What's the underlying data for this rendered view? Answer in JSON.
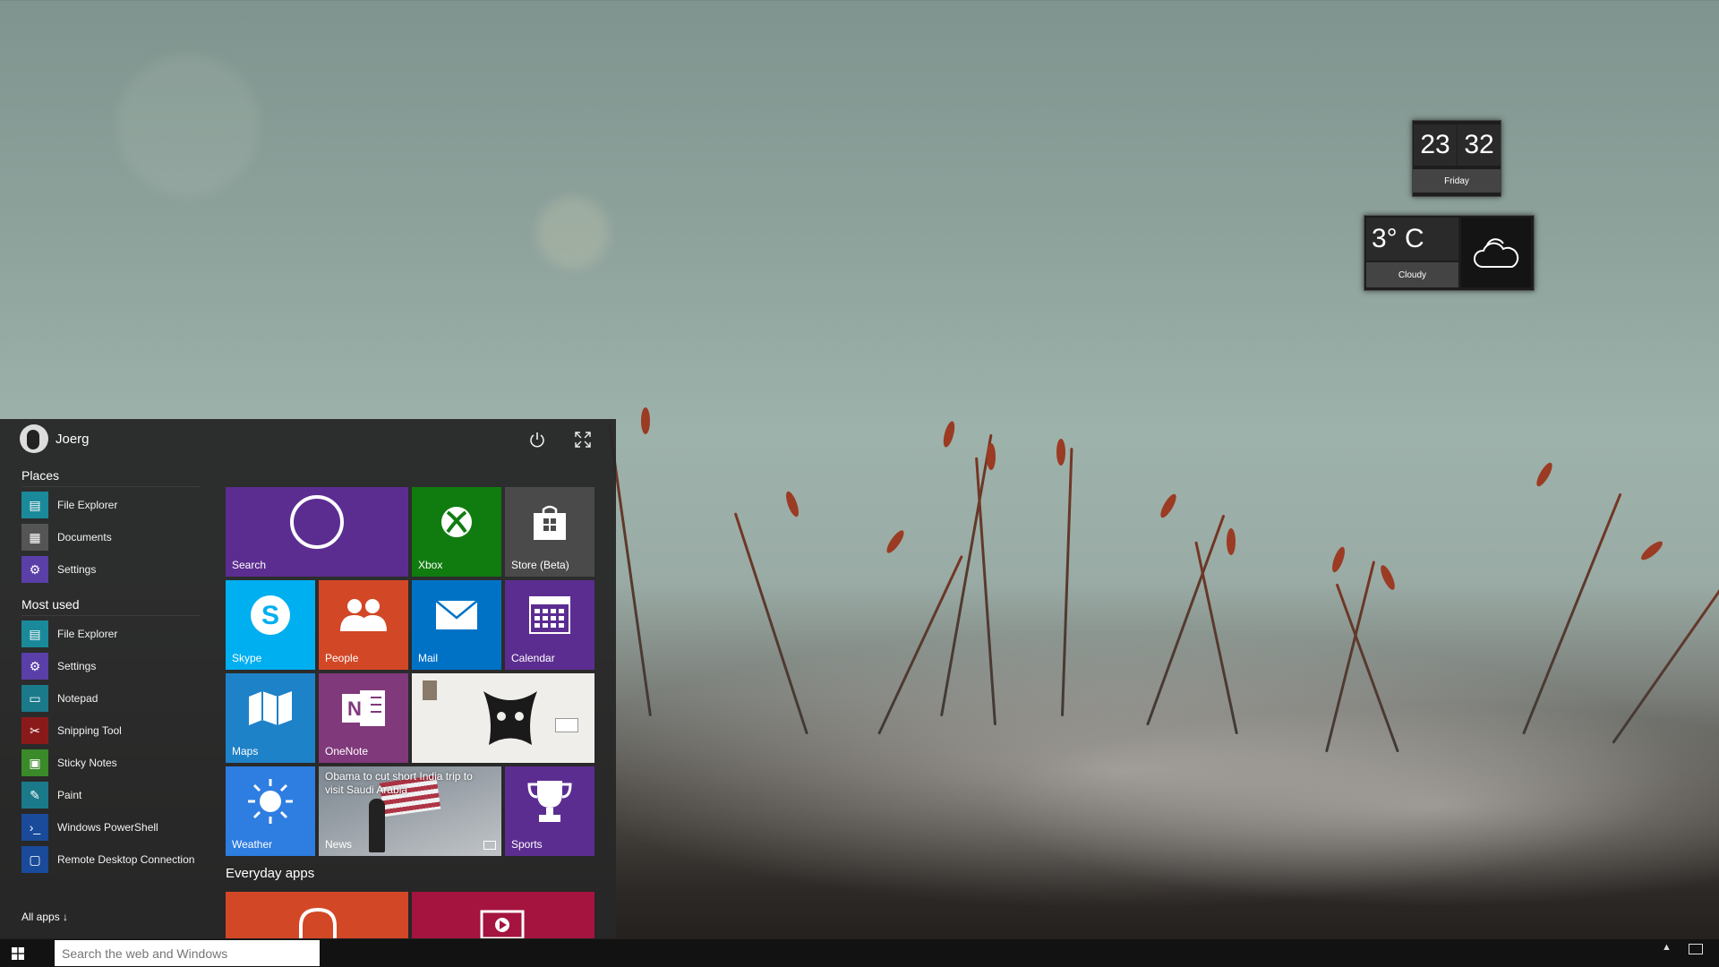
{
  "desktop": {
    "clock": {
      "hour": "23",
      "minute": "32",
      "day": "Friday"
    },
    "weather": {
      "temperature": "3° C",
      "condition": "Cloudy",
      "icon": "cloud-sun-icon"
    }
  },
  "start_menu": {
    "user": {
      "name": "Joerg"
    },
    "places_title": "Places",
    "places": [
      {
        "label": "File Explorer",
        "icon": "folder-icon",
        "color": "#1a8a9a"
      },
      {
        "label": "Documents",
        "icon": "documents-icon",
        "color": "#555555"
      },
      {
        "label": "Settings",
        "icon": "gear-icon",
        "color": "#5a3fa8"
      }
    ],
    "most_used_title": "Most used",
    "most_used": [
      {
        "label": "File Explorer",
        "icon": "folder-icon",
        "color": "#1a8a9a"
      },
      {
        "label": "Settings",
        "icon": "gear-icon",
        "color": "#5a3fa8"
      },
      {
        "label": "Notepad",
        "icon": "notepad-icon",
        "color": "#1a7a8a"
      },
      {
        "label": "Snipping Tool",
        "icon": "scissors-icon",
        "color": "#8a1a1a"
      },
      {
        "label": "Sticky Notes",
        "icon": "sticky-notes-icon",
        "color": "#3a8a2a"
      },
      {
        "label": "Paint",
        "icon": "paint-icon",
        "color": "#1a7a8a"
      },
      {
        "label": "Windows PowerShell",
        "icon": "powershell-icon",
        "color": "#1a4a9a"
      },
      {
        "label": "Remote Desktop Connection",
        "icon": "remote-desktop-icon",
        "color": "#1a4a9a"
      }
    ],
    "all_apps": "All apps ↓",
    "tiles": {
      "search": "Search",
      "xbox": "Xbox",
      "store": "Store (Beta)",
      "skype": "Skype",
      "people": "People",
      "mail": "Mail",
      "calendar": "Calendar",
      "maps": "Maps",
      "onenote": "OneNote",
      "weather": "Weather",
      "news": "News",
      "news_headline": "Obama to cut short India trip to visit Saudi Arabia",
      "sports": "Sports"
    },
    "everyday_apps_title": "Everyday apps",
    "colors": {
      "search": "#5c2d91",
      "xbox": "#107c10",
      "store": "#4a4a4a",
      "skype": "#00aff0",
      "people": "#d24726",
      "mail": "#0072c6",
      "calendar": "#5c2d91",
      "maps": "#1e82c8",
      "onenote": "#80397b",
      "weather": "#2e7de1",
      "sports": "#5c2d91",
      "music": "#d24726",
      "video": "#a4143f"
    }
  },
  "taskbar": {
    "search_placeholder": "Search the web and Windows"
  }
}
